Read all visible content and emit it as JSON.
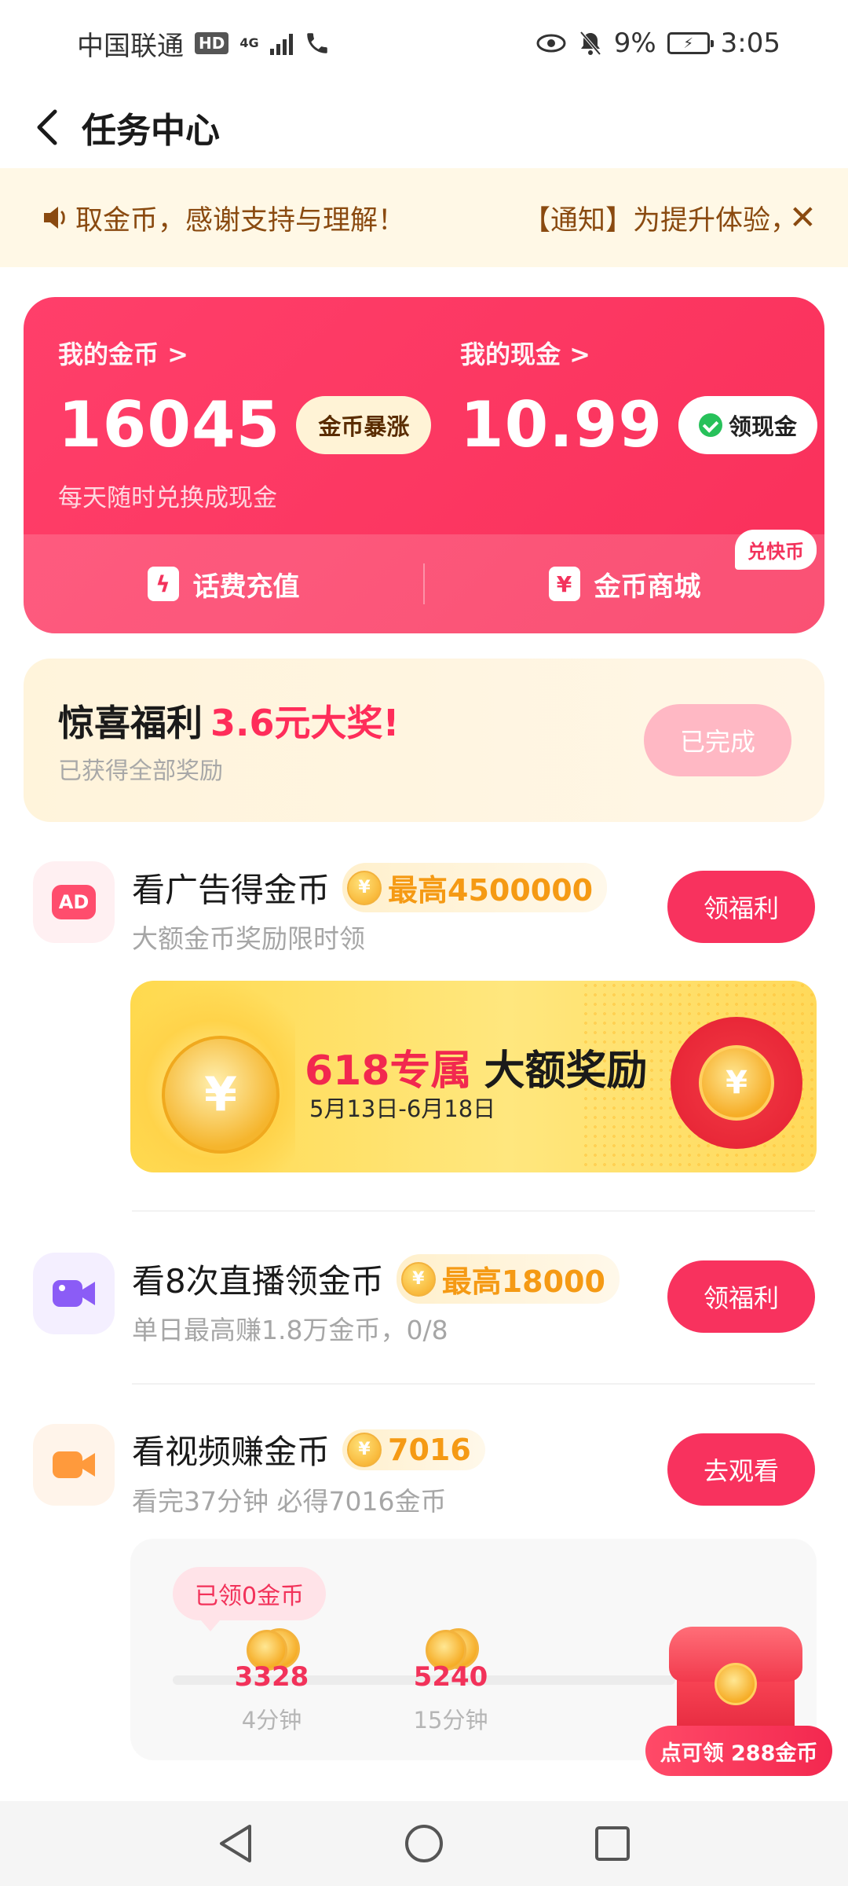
{
  "status_bar": {
    "carrier": "中国联通",
    "hd": "HD",
    "network": "4G",
    "battery_percent": "9%",
    "time": "3:05"
  },
  "header": {
    "title": "任务中心"
  },
  "notice": {
    "text_a": "取金币，感谢支持与理解！",
    "text_b": "【通知】为提升体验，"
  },
  "coin_card": {
    "coins_label": "我的金币 >",
    "coins_value": "16045",
    "coins_badge": "金币暴涨",
    "cash_label": "我的现金 >",
    "cash_value": "10.99",
    "cash_button": "领现金",
    "sub_text": "每天随时兑换成现金",
    "recharge_label": "话费充值",
    "mall_label": "金币商城",
    "mall_tag": "兑快币"
  },
  "surprise": {
    "title": "惊喜福利",
    "highlight": "3.6元大奖!",
    "sub": "已获得全部奖励",
    "button": "已完成"
  },
  "tasks": [
    {
      "title": "看广告得金币",
      "reward": "最高4500000",
      "sub": "大额金币奖励限时领",
      "button": "领福利",
      "icon": "ad-icon",
      "icon_text": "AD"
    },
    {
      "title": "看8次直播领金币",
      "reward": "最高18000",
      "sub": "单日最高赚1.8万金币，0/8",
      "button": "领福利",
      "icon": "video-camera-icon"
    },
    {
      "title": "看视频赚金币",
      "reward": "7016",
      "sub": "看完37分钟 必得7016金币",
      "button": "去观看",
      "icon": "video-icon"
    }
  ],
  "banner": {
    "title_red": "618专属",
    "title_black": "大额奖励",
    "date": "5月13日-6月18日"
  },
  "progress": {
    "received": "已领0金币",
    "milestones": [
      {
        "value": "3328",
        "label": "4分钟"
      },
      {
        "value": "5240",
        "label": "15分钟"
      }
    ],
    "claim_text": "点可领 288金币"
  },
  "colors": {
    "brand_red": "#f8325e",
    "coin_gold": "#f59a14",
    "notice_bg": "#fff8e6"
  }
}
